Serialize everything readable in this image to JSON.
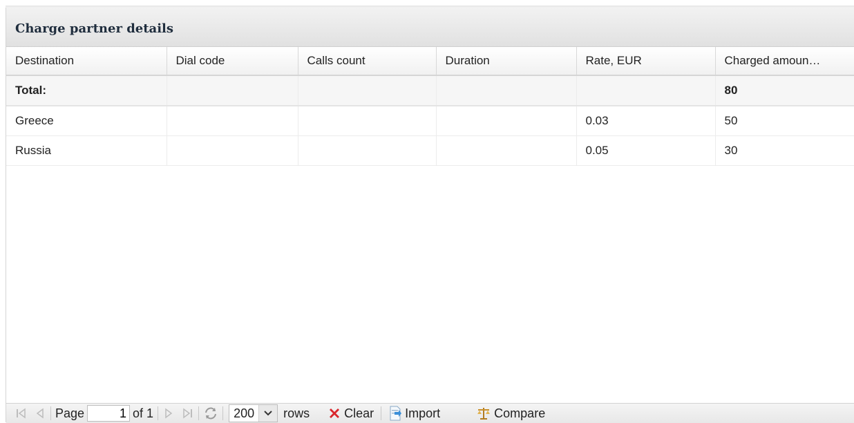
{
  "panel": {
    "title": "Charge partner details"
  },
  "table": {
    "columns": [
      "Destination",
      "Dial code",
      "Calls count",
      "Duration",
      "Rate, EUR",
      "Charged amoun…"
    ],
    "total": [
      "Total:",
      "",
      "",
      "",
      "",
      "80"
    ],
    "rows": [
      [
        "Greece",
        "",
        "",
        "",
        "0.03",
        "50"
      ],
      [
        "Russia",
        "",
        "",
        "",
        "0.05",
        "30"
      ]
    ]
  },
  "pager": {
    "page_label": "Page",
    "page_value": "1",
    "of_label": "of 1",
    "rows_value": "200",
    "rows_label": "rows",
    "clear_label": "Clear",
    "import_label": "Import",
    "compare_label": "Compare"
  },
  "icons": {
    "first": "first-page-icon",
    "prev": "prev-page-icon",
    "next": "next-page-icon",
    "last": "last-page-icon",
    "refresh": "refresh-icon",
    "clear": "clear-x-icon",
    "import": "import-icon",
    "compare": "compare-scales-icon"
  },
  "colors": {
    "clear_icon": "#d9262c",
    "import_icon": "#3a8fd9",
    "compare_icon": "#c9902b"
  }
}
